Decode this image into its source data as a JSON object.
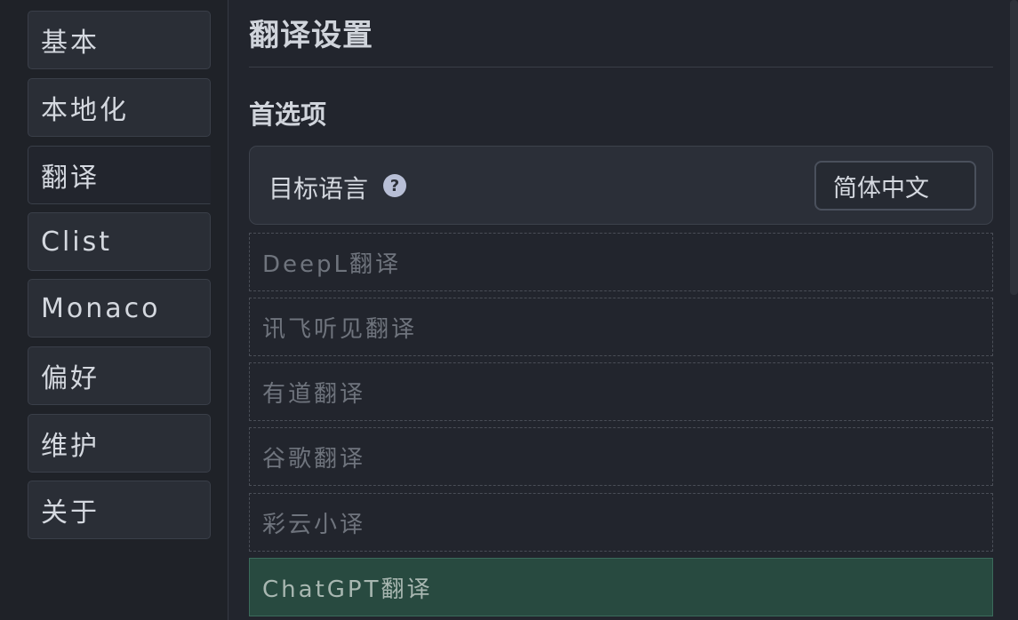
{
  "sidebar": {
    "items": [
      {
        "label": "基本"
      },
      {
        "label": "本地化"
      },
      {
        "label": "翻译"
      },
      {
        "label": "Clist"
      },
      {
        "label": "Monaco"
      },
      {
        "label": "偏好"
      },
      {
        "label": "维护"
      },
      {
        "label": "关于"
      }
    ],
    "active_label": "翻译"
  },
  "main": {
    "title": "翻译设置",
    "section_title": "首选项",
    "target_language": {
      "label": "目标语言",
      "help_glyph": "?",
      "selected_value": "简体中文"
    },
    "engines": [
      {
        "label": "DeepL翻译",
        "enabled": false
      },
      {
        "label": "讯飞听见翻译",
        "enabled": false
      },
      {
        "label": "有道翻译",
        "enabled": false
      },
      {
        "label": "谷歌翻译",
        "enabled": false
      },
      {
        "label": "彩云小译",
        "enabled": false
      },
      {
        "label": "ChatGPT翻译",
        "enabled": true
      }
    ]
  },
  "colors": {
    "background": "#22252d",
    "sidebar_background": "#1f2228",
    "enabled_engine_background": "#284a40"
  }
}
